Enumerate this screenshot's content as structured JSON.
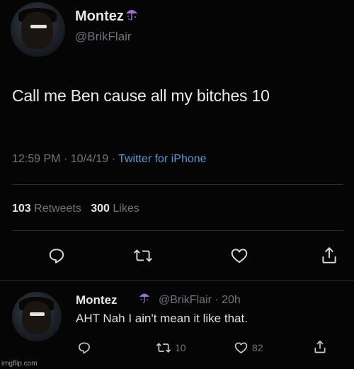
{
  "main_tweet": {
    "display_name": "Montez",
    "handle": "@BrikFlair",
    "text": "Call me Ben cause all my bitches 10",
    "time": "12:59 PM",
    "separator": "·",
    "date": "10/4/19",
    "source": "Twitter for iPhone",
    "retweets_count": "103",
    "retweets_label": "Retweets",
    "likes_count": "300",
    "likes_label": "Likes"
  },
  "reply_tweet": {
    "display_name": "Montez",
    "handle": "@BrikFlair",
    "separator": "·",
    "age": "20h",
    "text": "AHT Nah I ain't mean it like that.",
    "retweets": "10",
    "likes": "82"
  },
  "watermark": "imgflip.com",
  "colors": {
    "background": "#050506",
    "link": "#5a98d6",
    "muted": "#6e767d",
    "umbrella": "#9b6fd6"
  }
}
